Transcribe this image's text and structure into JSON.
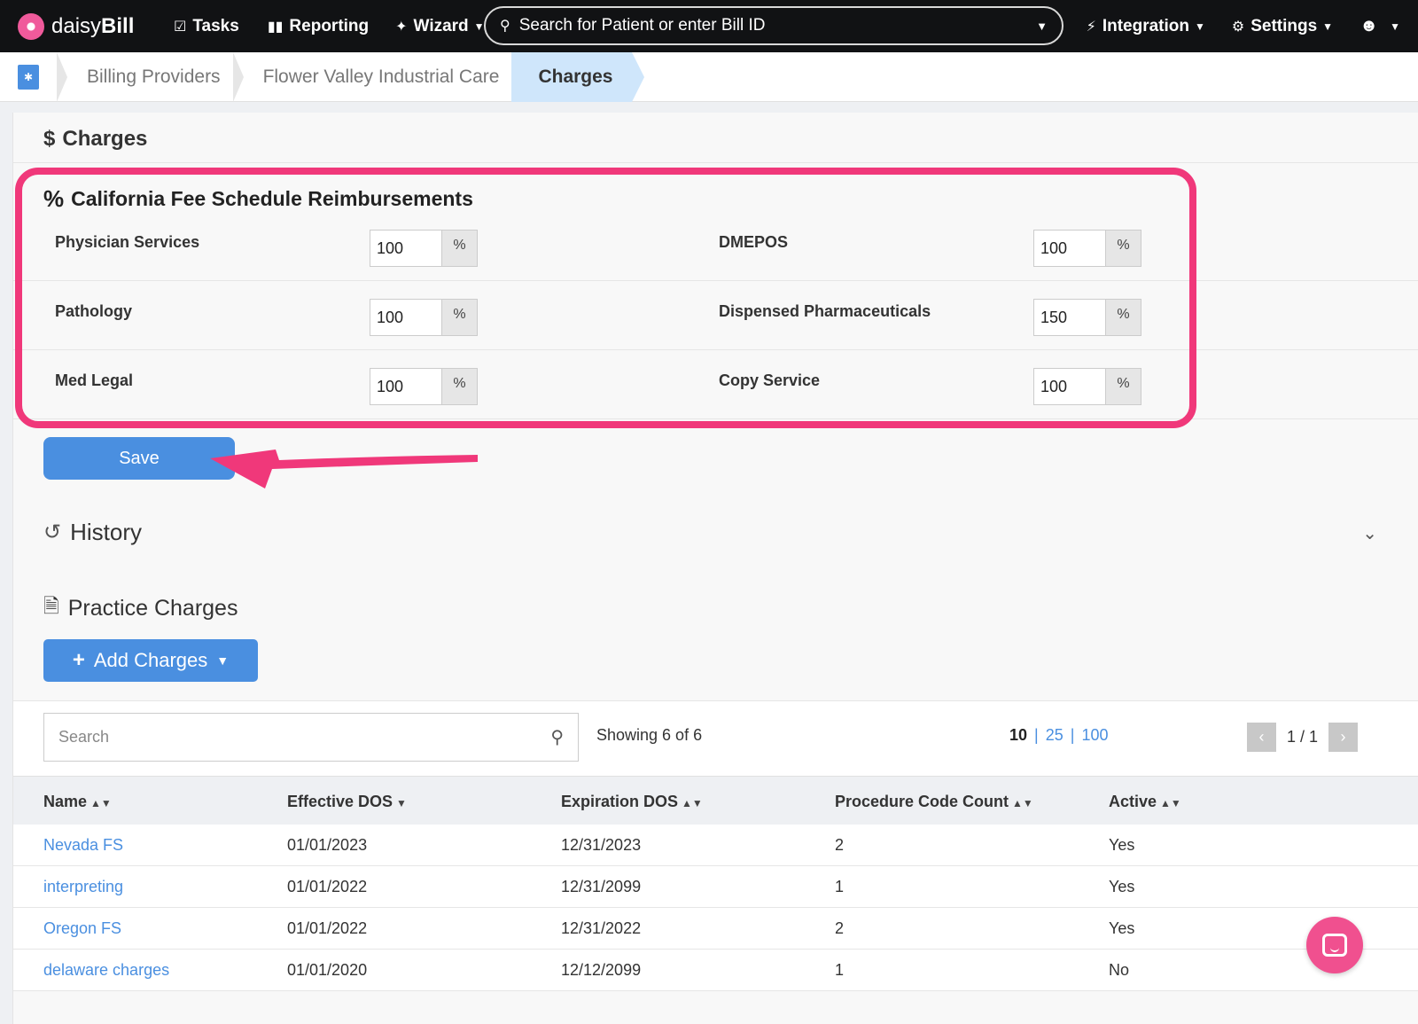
{
  "nav": {
    "brand_light": "daisy",
    "brand_bold": "Bill",
    "tasks": "Tasks",
    "reporting": "Reporting",
    "wizard": "Wizard",
    "search_placeholder": "Search for Patient or enter Bill ID",
    "integration": "Integration",
    "settings": "Settings"
  },
  "breadcrumb": {
    "items": [
      "Billing Providers",
      "Flower Valley Industrial Care"
    ],
    "active": "Charges"
  },
  "charges": {
    "title": "Charges",
    "fee_title": "California Fee Schedule Reimbursements",
    "unit": "%",
    "fees": [
      {
        "label": "Physician Services",
        "value": "100"
      },
      {
        "label": "DMEPOS",
        "value": "100"
      },
      {
        "label": "Pathology",
        "value": "100"
      },
      {
        "label": "Dispensed Pharmaceuticals",
        "value": "150"
      },
      {
        "label": "Med Legal",
        "value": "100"
      },
      {
        "label": "Copy Service",
        "value": "100"
      }
    ],
    "save": "Save"
  },
  "history": {
    "title": "History"
  },
  "practice_charges": {
    "title": "Practice Charges",
    "add_button": "Add Charges",
    "search_placeholder": "Search",
    "showing": "Showing 6 of 6",
    "per_page": {
      "current": "10",
      "options": [
        "25",
        "100"
      ],
      "separator": "|"
    },
    "page_info": "1 / 1",
    "columns": [
      "Name",
      "Effective DOS",
      "Expiration DOS",
      "Procedure Code Count",
      "Active"
    ],
    "rows": [
      [
        "Nevada FS",
        "01/01/2023",
        "12/31/2023",
        "2",
        "Yes"
      ],
      [
        "interpreting",
        "01/01/2022",
        "12/31/2099",
        "1",
        "Yes"
      ],
      [
        "Oregon FS",
        "01/01/2022",
        "12/31/2022",
        "2",
        "Yes"
      ],
      [
        "delaware charges",
        "01/01/2020",
        "12/12/2099",
        "1",
        "No"
      ]
    ]
  },
  "colors": {
    "nav_bg": "#111214",
    "accent": "#4a8fe0",
    "highlight": "#f0387a",
    "breadcrumb_active": "#cfe6fb"
  }
}
